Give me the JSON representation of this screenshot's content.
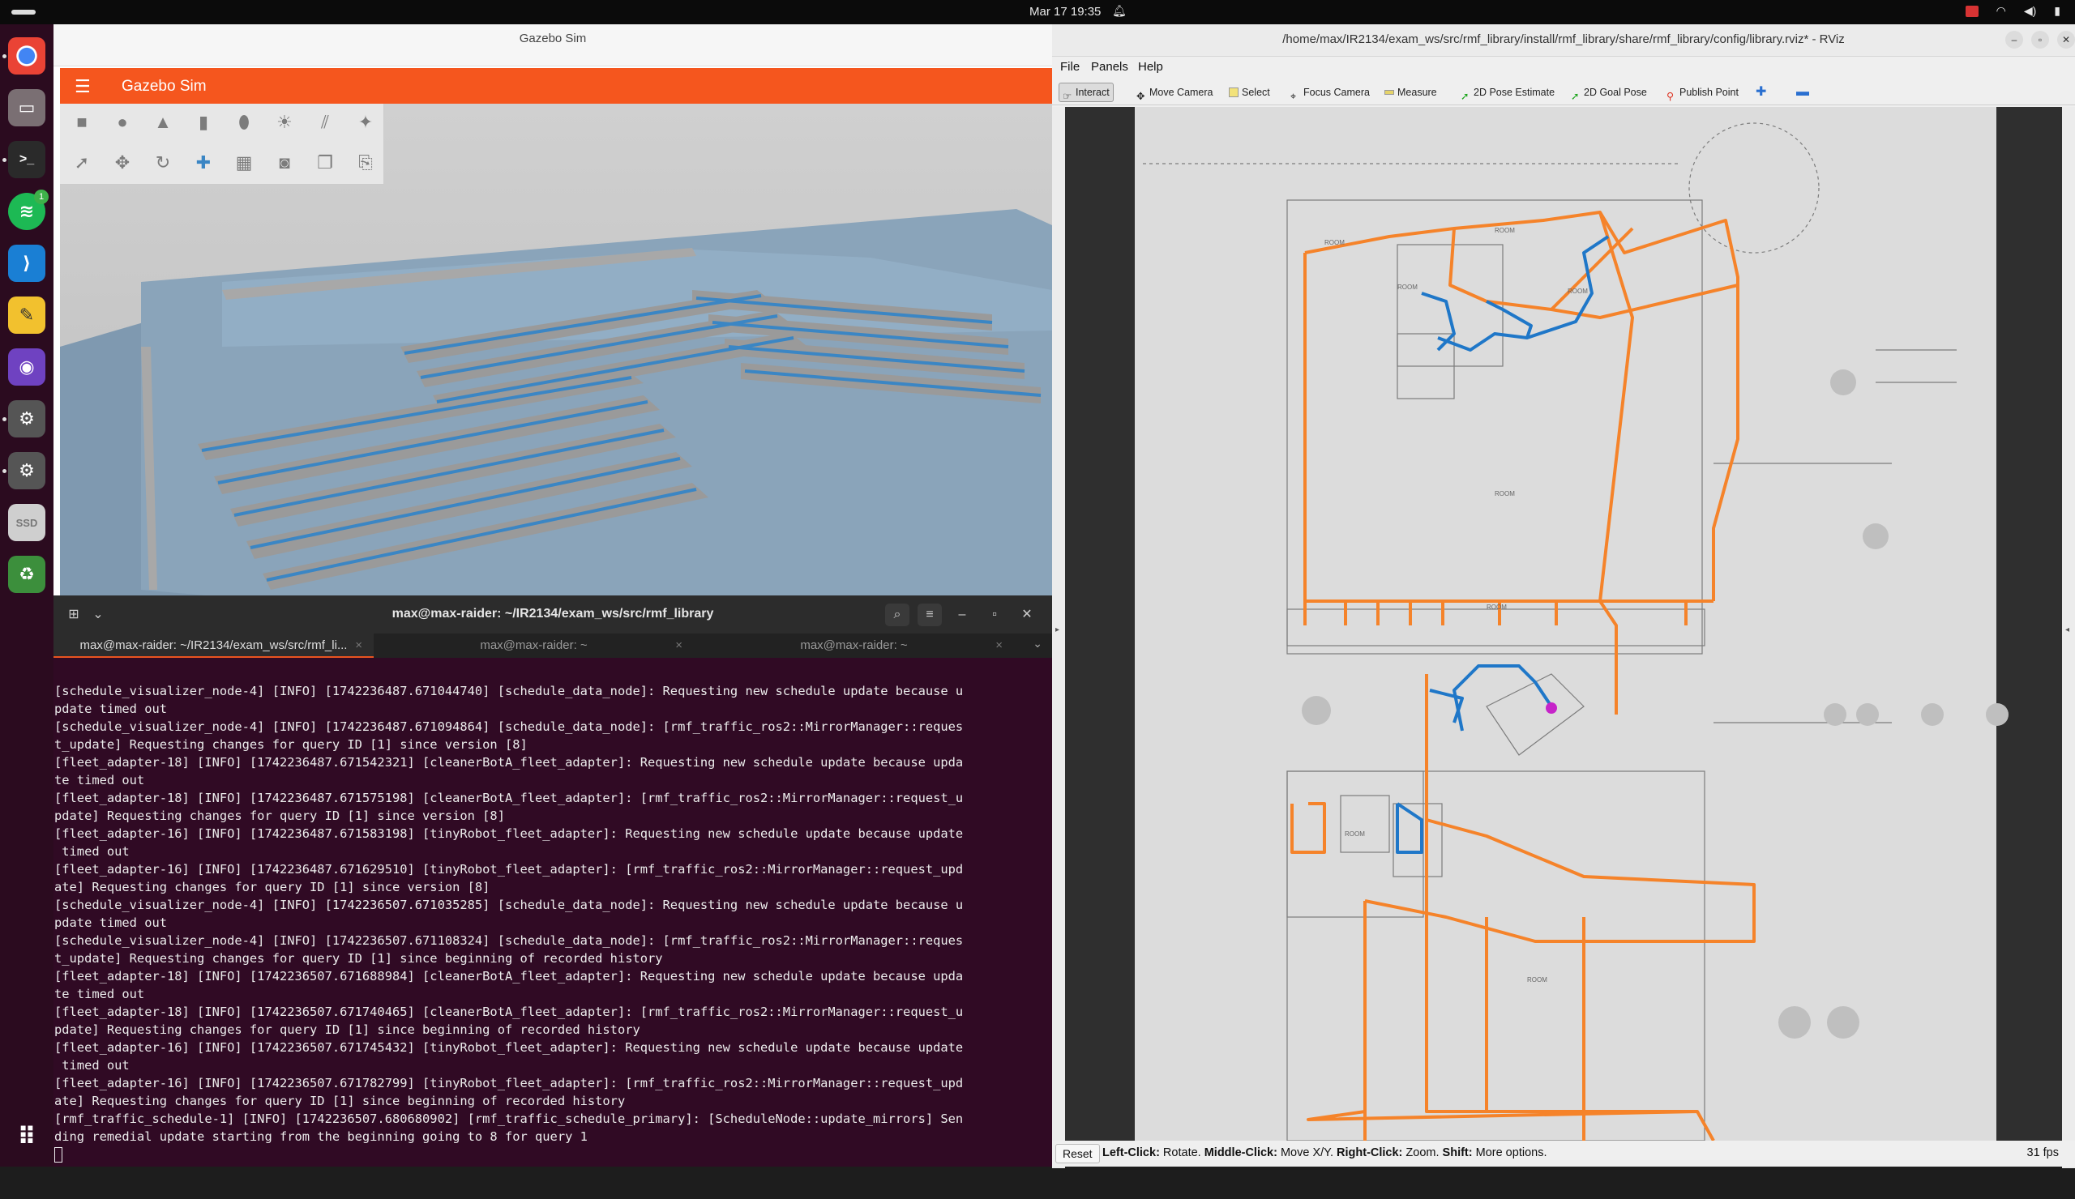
{
  "topbar": {
    "clock": "Mar 17  19:35"
  },
  "dock": {
    "items": [
      "chrome-icon",
      "files-icon",
      "terminal-icon",
      "spotify-icon",
      "vscode-icon",
      "text-editor-icon",
      "github-desktop-icon",
      "settings-icon",
      "settings-icon-2",
      "ssd-icon",
      "trash-icon"
    ],
    "spotify_badge": "1",
    "ssd_label": "SSD"
  },
  "gazebo": {
    "window_title": "Gazebo Sim",
    "app_title": "Gazebo Sim",
    "accent": "#f5561e"
  },
  "terminal": {
    "title": "max@max-raider: ~/IR2134/exam_ws/src/rmf_library",
    "tabs": [
      {
        "label": "max@max-raider: ~/IR2134/exam_ws/src/rmf_li..."
      },
      {
        "label": "max@max-raider: ~"
      },
      {
        "label": "max@max-raider: ~"
      }
    ],
    "lines": [
      "[schedule_visualizer_node-4] [INFO] [1742236487.671044740] [schedule_data_node]: Requesting new schedule update because u",
      "pdate timed out",
      "[schedule_visualizer_node-4] [INFO] [1742236487.671094864] [schedule_data_node]: [rmf_traffic_ros2::MirrorManager::reques",
      "t_update] Requesting changes for query ID [1] since version [8]",
      "[fleet_adapter-18] [INFO] [1742236487.671542321] [cleanerBotA_fleet_adapter]: Requesting new schedule update because upda",
      "te timed out",
      "[fleet_adapter-18] [INFO] [1742236487.671575198] [cleanerBotA_fleet_adapter]: [rmf_traffic_ros2::MirrorManager::request_u",
      "pdate] Requesting changes for query ID [1] since version [8]",
      "[fleet_adapter-16] [INFO] [1742236487.671583198] [tinyRobot_fleet_adapter]: Requesting new schedule update because update",
      " timed out",
      "[fleet_adapter-16] [INFO] [1742236487.671629510] [tinyRobot_fleet_adapter]: [rmf_traffic_ros2::MirrorManager::request_upd",
      "ate] Requesting changes for query ID [1] since version [8]",
      "[schedule_visualizer_node-4] [INFO] [1742236507.671035285] [schedule_data_node]: Requesting new schedule update because u",
      "pdate timed out",
      "[schedule_visualizer_node-4] [INFO] [1742236507.671108324] [schedule_data_node]: [rmf_traffic_ros2::MirrorManager::reques",
      "t_update] Requesting changes for query ID [1] since beginning of recorded history",
      "[fleet_adapter-18] [INFO] [1742236507.671688984] [cleanerBotA_fleet_adapter]: Requesting new schedule update because upda",
      "te timed out",
      "[fleet_adapter-18] [INFO] [1742236507.671740465] [cleanerBotA_fleet_adapter]: [rmf_traffic_ros2::MirrorManager::request_u",
      "pdate] Requesting changes for query ID [1] since beginning of recorded history",
      "[fleet_adapter-16] [INFO] [1742236507.671745432] [tinyRobot_fleet_adapter]: Requesting new schedule update because update",
      " timed out",
      "[fleet_adapter-16] [INFO] [1742236507.671782799] [tinyRobot_fleet_adapter]: [rmf_traffic_ros2::MirrorManager::request_upd",
      "ate] Requesting changes for query ID [1] since beginning of recorded history",
      "[rmf_traffic_schedule-1] [INFO] [1742236507.680680902] [rmf_traffic_schedule_primary]: [ScheduleNode::update_mirrors] Sen",
      "ding remedial update starting from the beginning going to 8 for query 1"
    ]
  },
  "rviz": {
    "window_title": "/home/max/IR2134/exam_ws/src/rmf_library/install/rmf_library/share/rmf_library/config/library.rviz* - RViz",
    "menu": [
      "File",
      "Panels",
      "Help"
    ],
    "tools": [
      "Interact",
      "Move Camera",
      "Select",
      "Focus Camera",
      "Measure",
      "2D Pose Estimate",
      "2D Goal Pose",
      "Publish Point"
    ],
    "status": {
      "reset": "Reset",
      "help_parts": [
        {
          "bold": "Left-Click:",
          "text": " Rotate. "
        },
        {
          "bold": "Middle-Click:",
          "text": " Move X/Y. "
        },
        {
          "bold": "Right-Click:",
          "text": " Zoom. "
        },
        {
          "bold": "Shift:",
          "text": " More options."
        }
      ],
      "fps": "31 fps"
    },
    "colors": {
      "lanes": "#f5832a",
      "robot_path": "#1f77c8",
      "robot": "#c624c9"
    }
  }
}
